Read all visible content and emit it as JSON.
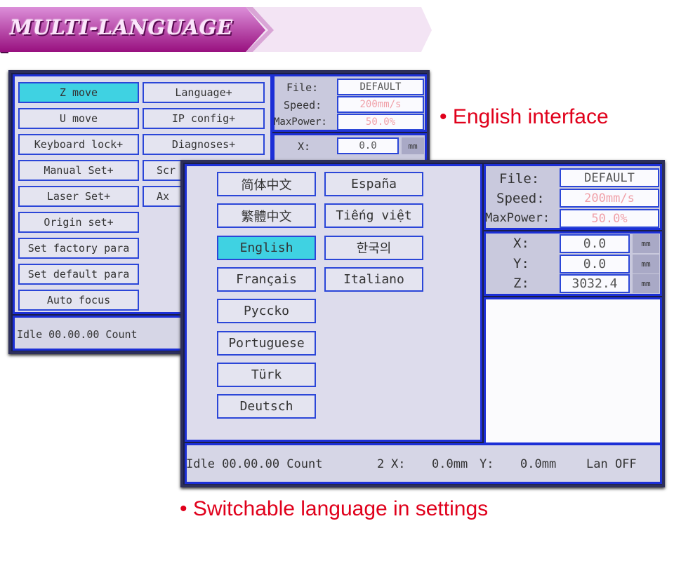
{
  "banner": {
    "title": "MULTI-LANGUAGE",
    "colors": {
      "primary": "#a0178f",
      "light": "#f3e4f4"
    }
  },
  "captions": {
    "english_interface": "English interface",
    "switchable": "Switchable language in settings",
    "color": "#e0001b"
  },
  "back_screen": {
    "menu_left": [
      "Z move",
      "U move",
      "Keyboard lock+",
      "Manual Set+",
      "Laser Set+",
      "Origin set+",
      "Set factory para",
      "Set default para",
      "Auto focus"
    ],
    "menu_right": [
      "Language+",
      "IP config+",
      "Diagnoses+",
      "Scr",
      "Ax"
    ],
    "selected": "Z move",
    "file_label": "File:",
    "file_value": "DEFAULT",
    "speed_label": "Speed:",
    "speed_value": "200mm/s",
    "power_label": "MaxPower:",
    "power_value": "50.0%",
    "x_label": "X:",
    "x_value": "0.0",
    "unit": "mm",
    "status": "Idle 00.00.00 Count"
  },
  "front_screen": {
    "languages_left": [
      "简体中文",
      "繁體中文",
      "English",
      "Français",
      "Pyccko",
      "Portuguese",
      "Türk",
      "Deutsch"
    ],
    "languages_right": [
      "España",
      "Tiếng việt",
      "한국의",
      "Italiano"
    ],
    "selected": "English",
    "file_label": "File:",
    "file_value": "DEFAULT",
    "speed_label": "Speed:",
    "speed_value": "200mm/s",
    "power_label": "MaxPower:",
    "power_value": "50.0%",
    "axes": [
      {
        "label": "X:",
        "value": "0.0",
        "unit": "mm"
      },
      {
        "label": "Y:",
        "value": "0.0",
        "unit": "mm"
      },
      {
        "label": "Z:",
        "value": "3032.4",
        "unit": "mm"
      }
    ],
    "status": {
      "state": "Idle 00.00.00 Count",
      "count": "2",
      "x_label": "X:",
      "x_value": "0.0mm",
      "y_label": "Y:",
      "y_value": "0.0mm",
      "lan": "Lan OFF"
    }
  }
}
